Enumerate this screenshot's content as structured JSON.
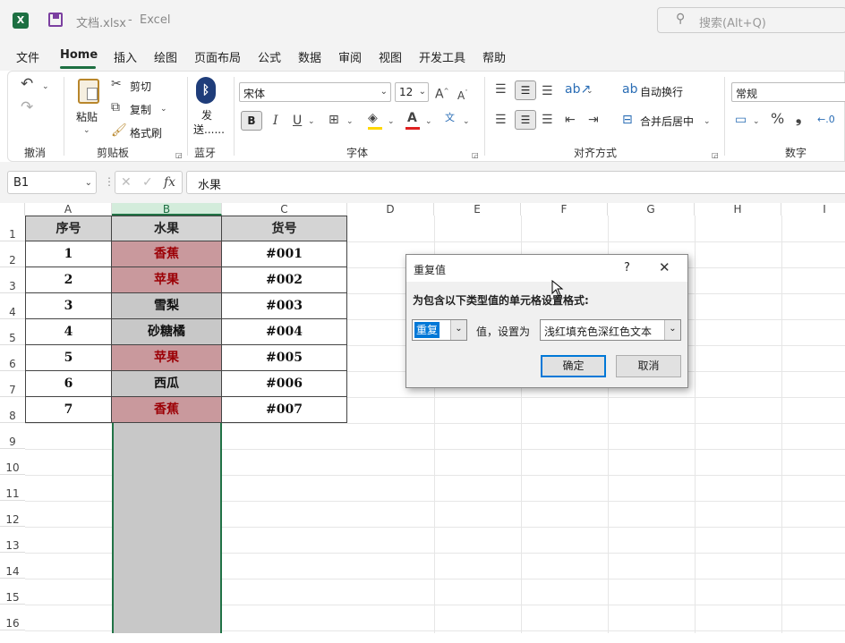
{
  "title": {
    "file": "文档.xlsx",
    "sep": "-",
    "app": "Excel",
    "search": "搜索(Alt+Q)"
  },
  "menu": [
    "文件",
    "Home",
    "插入",
    "绘图",
    "页面布局",
    "公式",
    "数据",
    "审阅",
    "视图",
    "开发工具",
    "帮助"
  ],
  "ribbon": {
    "undo_group": "撤消",
    "clipboard": {
      "paste": "粘贴",
      "cut": "剪切",
      "copy": "复制",
      "painter": "格式刷",
      "group": "剪贴板"
    },
    "bluetooth": {
      "send1": "发",
      "send2": "送......",
      "group": "蓝牙"
    },
    "font": {
      "name": "宋体",
      "size": "12",
      "bold": "B",
      "italic": "I",
      "underline": "U",
      "group": "字体"
    },
    "align": {
      "wrap": "自动换行",
      "merge": "合并后居中",
      "group": "对齐方式"
    },
    "number": {
      "format": "常规",
      "percent": "%",
      "group": "数字"
    }
  },
  "formula": {
    "namebox": "B1",
    "fx": "fx",
    "content": "水果"
  },
  "columns": [
    "A",
    "B",
    "C",
    "D",
    "E",
    "F",
    "G",
    "H",
    "I"
  ],
  "rows": [
    "1",
    "2",
    "3",
    "4",
    "5",
    "6",
    "7",
    "8",
    "9",
    "10",
    "11",
    "12",
    "13",
    "14",
    "15",
    "16"
  ],
  "table": {
    "header": [
      "序号",
      "水果",
      "货号"
    ],
    "rows": [
      {
        "n": "1",
        "fruit": "香蕉",
        "code": "#001",
        "dup": true
      },
      {
        "n": "2",
        "fruit": "苹果",
        "code": "#002",
        "dup": true
      },
      {
        "n": "3",
        "fruit": "雪梨",
        "code": "#003",
        "dup": false
      },
      {
        "n": "4",
        "fruit": "砂糖橘",
        "code": "#004",
        "dup": false
      },
      {
        "n": "5",
        "fruit": "苹果",
        "code": "#005",
        "dup": true
      },
      {
        "n": "6",
        "fruit": "西瓜",
        "code": "#006",
        "dup": false
      },
      {
        "n": "7",
        "fruit": "香蕉",
        "code": "#007",
        "dup": true
      }
    ]
  },
  "dialog": {
    "title": "重复值",
    "help": "?",
    "prompt": "为包含以下类型值的单元格设置格式:",
    "type": "重复",
    "value_label": "值，设置为",
    "format": "浅红填充色深红色文本",
    "ok": "确定",
    "cancel": "取消"
  },
  "colors": {
    "dup_fill": "#c9999d",
    "dup_text": "#9c0006",
    "sel_fill": "#c8c8c8",
    "header_fill": "#d4d4d4",
    "sel_border": "#217346",
    "arrow": "#e02020"
  }
}
